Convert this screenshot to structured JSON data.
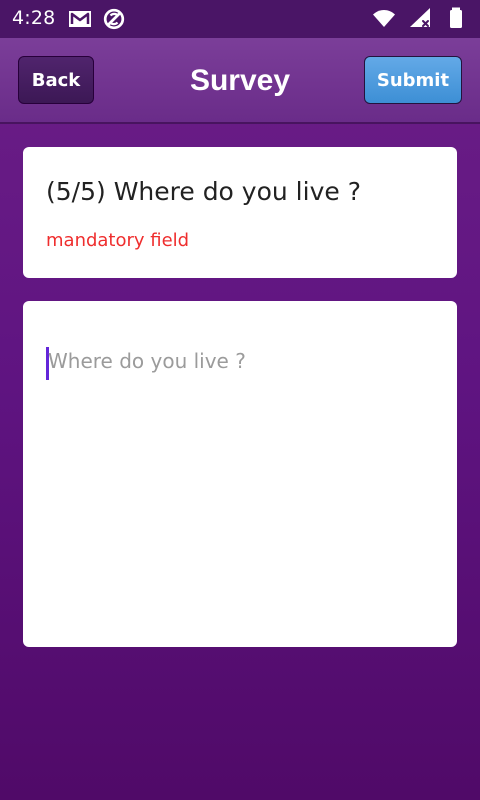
{
  "status_bar": {
    "time": "4:28",
    "left_icons": [
      "gmail-icon",
      "no-sync-icon"
    ],
    "right_icons": [
      "wifi-icon",
      "cellular-signal-icon",
      "battery-icon"
    ]
  },
  "toolbar": {
    "back_label": "Back",
    "title": "Survey",
    "submit_label": "Submit"
  },
  "question": {
    "title": "(5/5) Where do you live ?",
    "mandatory_text": "mandatory field"
  },
  "answer": {
    "placeholder": "Where do you live ?",
    "value": ""
  },
  "colors": {
    "background_top": "#6c1f87",
    "background_bottom": "#500a68",
    "status_bar": "#4a1566",
    "toolbar": "#73348f",
    "back_button": "#3c1855",
    "submit_button": "#4d9ade",
    "mandatory_text": "#ef2e2e",
    "cursor": "#6326d9",
    "card": "#ffffff"
  }
}
